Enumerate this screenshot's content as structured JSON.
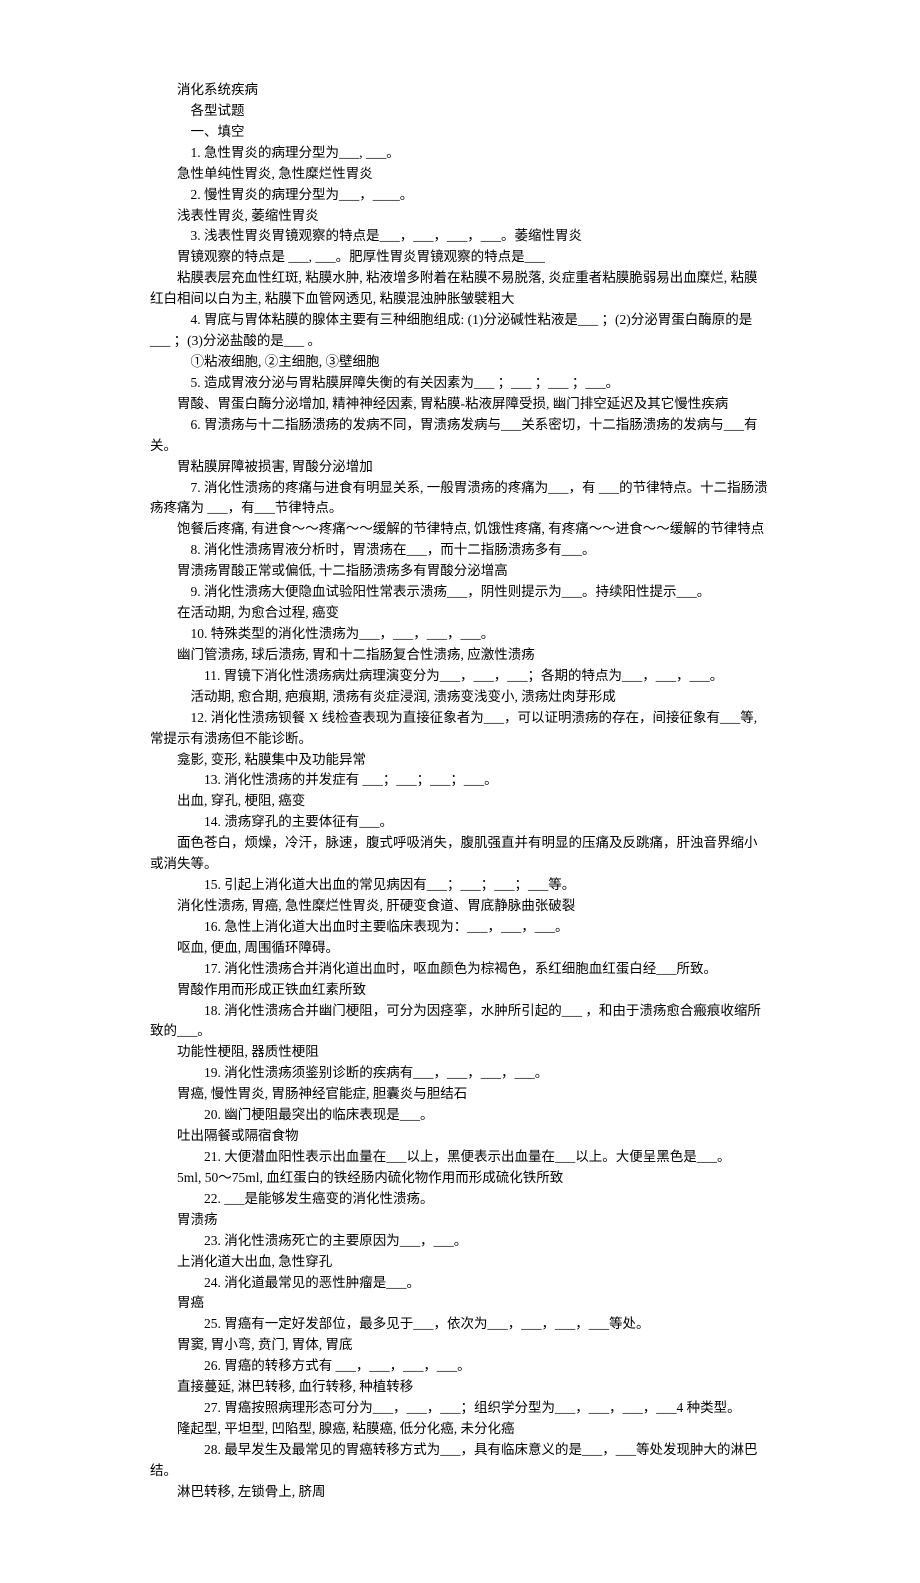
{
  "lines": [
    {
      "cls": "indent1",
      "text": "消化系统疾病"
    },
    {
      "cls": "indent2",
      "text": "各型试题"
    },
    {
      "cls": "indent2",
      "text": "一、填空"
    },
    {
      "cls": "indent2",
      "text": "1. 急性胃炎的病理分型为___, ___。"
    },
    {
      "cls": "indent1",
      "text": "急性单纯性胃炎, 急性糜烂性胃炎"
    },
    {
      "cls": "indent2",
      "text": "2. 慢性胃炎的病理分型为___，____。"
    },
    {
      "cls": "indent1",
      "text": "浅表性胃炎, 萎缩性胃炎"
    },
    {
      "cls": "indent2",
      "text": "3. 浅表性胃炎胃镜观察的特点是___，___，___，___。萎缩性胃炎"
    },
    {
      "cls": "indent1",
      "text": "胃镜观察的特点是 ___, ___。肥厚性胃炎胃镜观察的特点是___"
    },
    {
      "cls": "indent1",
      "text": "粘膜表层充血性红斑, 粘膜水肿, 粘液增多附着在粘膜不易脱落, 炎症重者粘膜脆弱易出血糜烂, 粘膜红白相间以白为主, 粘膜下血管网透见, 粘膜混浊肿胀皱襞粗大"
    },
    {
      "cls": "indent2",
      "text": "4. 胃底与胃体粘膜的腺体主要有三种细胞组成: (1)分泌碱性粘液是___ ；(2)分泌胃蛋白酶原的是 ___ ；(3)分泌盐酸的是___ 。"
    },
    {
      "cls": "indent2",
      "text": "①粘液细胞, ②主细胞, ③壁细胞"
    },
    {
      "cls": "indent2",
      "text": "5. 造成胃液分泌与胃粘膜屏障失衡的有关因素为___ ；___ ；___ ；___。"
    },
    {
      "cls": "indent1",
      "text": "胃酸、胃蛋白酶分泌增加, 精神神经因素, 胃粘膜-粘液屏障受损, 幽门排空延迟及其它慢性疾病"
    },
    {
      "cls": "indent2",
      "text": "6. 胃溃疡与十二指肠溃疡的发病不同，胃溃疡发病与___关系密切，十二指肠溃疡的发病与___有关。"
    },
    {
      "cls": "indent1",
      "text": "胃粘膜屏障被损害, 胃酸分泌增加"
    },
    {
      "cls": "indent2",
      "text": "7. 消化性溃疡的疼痛与进食有明显关系, 一般胃溃疡的疼痛为___，有 ___的节律特点。十二指肠溃疡疼痛为 ___，有___节律特点。"
    },
    {
      "cls": "indent1",
      "text": "饱餐后疼痛, 有进食～～疼痛～～缓解的节律特点, 饥饿性疼痛, 有疼痛～～进食～～缓解的节律特点"
    },
    {
      "cls": "indent2",
      "text": "8. 消化性溃疡胃液分析时，胃溃疡在___，而十二指肠溃疡多有___。"
    },
    {
      "cls": "indent1",
      "text": "胃溃疡胃酸正常或偏低, 十二指肠溃疡多有胃酸分泌增高"
    },
    {
      "cls": "indent2",
      "text": "9. 消化性溃疡大便隐血试验阳性常表示溃疡___，阴性则提示为___。持续阳性提示___。"
    },
    {
      "cls": "indent1",
      "text": "在活动期, 为愈合过程, 癌变"
    },
    {
      "cls": "indent2",
      "text": "10. 特殊类型的消化性溃疡为___，___，___，___。"
    },
    {
      "cls": "indent1",
      "text": "幽门管溃疡, 球后溃疡, 胃和十二指肠复合性溃疡, 应激性溃疡"
    },
    {
      "cls": "indent3",
      "text": "11. 胃镜下消化性溃疡病灶病理演变分为___，___，___；各期的特点为___，___，___。"
    },
    {
      "cls": "indent2",
      "text": "活动期, 愈合期, 疤痕期, 溃疡有炎症浸润, 溃疡变浅变小, 溃疡灶肉芽形成"
    },
    {
      "cls": "indent2",
      "text": "12. 消化性溃疡钡餐 X 线检查表现为直接征象者为___，可以证明溃疡的存在，间接征象有___等, 常提示有溃疡但不能诊断。"
    },
    {
      "cls": "indent1",
      "text": "龛影, 变形, 粘膜集中及功能异常"
    },
    {
      "cls": "indent3",
      "text": "13. 消化性溃疡的并发症有 ___；___；___；___。"
    },
    {
      "cls": "indent1",
      "text": "出血, 穿孔, 梗阻, 癌变"
    },
    {
      "cls": "indent3",
      "text": "14. 溃疡穿孔的主要体征有___。"
    },
    {
      "cls": "indent1",
      "text": "面色苍白，烦燥，冷汗，脉速，腹式呼吸消失，腹肌强直并有明显的压痛及反跳痛，肝浊音界缩小或消失等。"
    },
    {
      "cls": "indent3",
      "text": "15. 引起上消化道大出血的常见病因有___；___；___；___等。"
    },
    {
      "cls": "indent1",
      "text": "消化性溃疡, 胃癌, 急性糜烂性胃炎, 肝硬变食道、胃底静脉曲张破裂"
    },
    {
      "cls": "indent3",
      "text": "16. 急性上消化道大出血时主要临床表现为：___，___，___。"
    },
    {
      "cls": "indent1",
      "text": "呕血, 便血, 周围循环障碍。"
    },
    {
      "cls": "indent3",
      "text": "17. 消化性溃疡合并消化道出血时，呕血颜色为棕褐色，系红细胞血红蛋白经___所致。"
    },
    {
      "cls": "indent1",
      "text": "胃酸作用而形成正铁血红素所致"
    },
    {
      "cls": "indent3",
      "text": "18. 消化性溃疡合并幽门梗阻，可分为因痉挛，水肿所引起的___ ，和由于溃疡愈合瘢痕收缩所致的___。"
    },
    {
      "cls": "indent1",
      "text": "功能性梗阻, 器质性梗阻"
    },
    {
      "cls": "indent3",
      "text": "19. 消化性溃疡须鉴别诊断的疾病有___，___，___，___。"
    },
    {
      "cls": "indent1",
      "text": "胃癌, 慢性胃炎, 胃肠神经官能症, 胆囊炎与胆结石"
    },
    {
      "cls": "indent3",
      "text": "20. 幽门梗阻最突出的临床表现是___。"
    },
    {
      "cls": "indent1",
      "text": "吐出隔餐或隔宿食物"
    },
    {
      "cls": "indent3",
      "text": "21. 大便潜血阳性表示出血量在___以上，黑便表示出血量在___以上。大便呈黑色是___。"
    },
    {
      "cls": "indent1",
      "text": "5ml, 50～75ml, 血红蛋白的铁经肠内硫化物作用而形成硫化铁所致"
    },
    {
      "cls": "indent3",
      "text": "22. ___是能够发生癌变的消化性溃疡。"
    },
    {
      "cls": "indent1",
      "text": "胃溃疡"
    },
    {
      "cls": "indent3",
      "text": "23. 消化性溃疡死亡的主要原因为___，___。"
    },
    {
      "cls": "indent1",
      "text": "上消化道大出血, 急性穿孔"
    },
    {
      "cls": "indent3",
      "text": "24. 消化道最常见的恶性肿瘤是___。"
    },
    {
      "cls": "indent1",
      "text": "胃癌"
    },
    {
      "cls": "indent3",
      "text": "25. 胃癌有一定好发部位，最多见于___，依次为___，___，___，___等处。"
    },
    {
      "cls": "indent1",
      "text": "胃窦, 胃小弯, 贲门, 胃体, 胃底"
    },
    {
      "cls": "indent3",
      "text": "26. 胃癌的转移方式有 ___，___，___，___。"
    },
    {
      "cls": "indent1",
      "text": "直接蔓延, 淋巴转移, 血行转移, 种植转移"
    },
    {
      "cls": "indent3",
      "text": "27. 胃癌按照病理形态可分为___，___，___；组织学分型为___，___，___，___4 种类型。"
    },
    {
      "cls": "indent1",
      "text": "隆起型, 平坦型, 凹陷型, 腺癌, 粘膜癌, 低分化癌, 未分化癌"
    },
    {
      "cls": "indent3",
      "text": "28. 最早发生及最常见的胃癌转移方式为___，具有临床意义的是___，___等处发现肿大的淋巴结。"
    },
    {
      "cls": "indent1",
      "text": "淋巴转移, 左锁骨上, 脐周"
    }
  ]
}
